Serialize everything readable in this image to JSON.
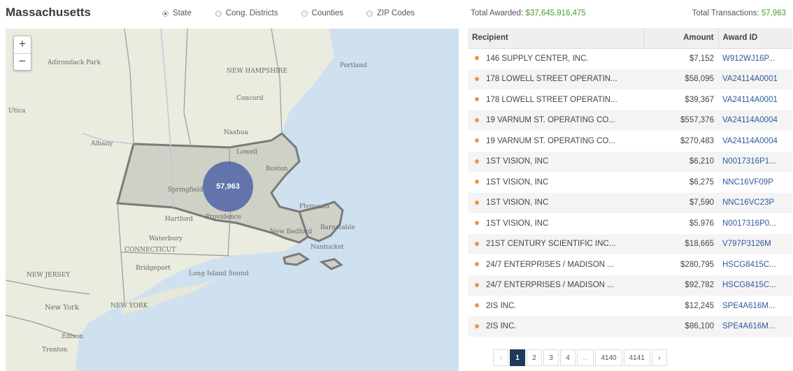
{
  "header": {
    "title": "Massachusetts",
    "radios": [
      {
        "label": "State",
        "selected": true
      },
      {
        "label": "Cong. Districts",
        "selected": false
      },
      {
        "label": "Counties",
        "selected": false
      },
      {
        "label": "ZIP Codes",
        "selected": false
      }
    ],
    "total_awarded_label": "Total Awarded:",
    "total_awarded_value": "$37,645,916,475",
    "total_transactions_label": "Total Transactions:",
    "total_transactions_value": "57,963"
  },
  "map": {
    "zoom_in": "+",
    "zoom_out": "−",
    "bubble_value": "57,963",
    "place_labels": [
      "Adirondack Park",
      "Utica",
      "Albany",
      "NEW HAMPSHIRE",
      "Concord",
      "Nashua",
      "Lowell",
      "Boston",
      "Springfield",
      "Providence",
      "Hartford",
      "Waterbury",
      "CONNECTICUT",
      "Bridgeport",
      "NEW JERSEY",
      "New York",
      "NEW YORK",
      "Long Island Sound",
      "Trenton",
      "Portland",
      "Plymouth",
      "New Bedford",
      "Barnstable",
      "Edison",
      "Nantucket"
    ],
    "colors": {
      "water": "#cfe0ee",
      "land": "#e9ecdf",
      "massachusetts": "#cfd0c6",
      "bubble": "#5466a8"
    }
  },
  "table": {
    "columns": [
      "Recipient",
      "Amount",
      "Award ID"
    ],
    "rows": [
      {
        "recipient": "146 SUPPLY CENTER, INC.",
        "amount": "$7,152",
        "award_id": "W912WJ16P..."
      },
      {
        "recipient": "178 LOWELL STREET OPERATIN...",
        "amount": "$58,095",
        "award_id": "VA24114A0001"
      },
      {
        "recipient": "178 LOWELL STREET OPERATIN...",
        "amount": "$39,367",
        "award_id": "VA24114A0001"
      },
      {
        "recipient": "19 VARNUM ST. OPERATING CO...",
        "amount": "$557,376",
        "award_id": "VA24114A0004"
      },
      {
        "recipient": "19 VARNUM ST. OPERATING CO...",
        "amount": "$270,483",
        "award_id": "VA24114A0004"
      },
      {
        "recipient": "1ST VISION, INC",
        "amount": "$6,210",
        "award_id": "N0017316P1..."
      },
      {
        "recipient": "1ST VISION, INC",
        "amount": "$6,275",
        "award_id": "NNC16VF09P"
      },
      {
        "recipient": "1ST VISION, INC",
        "amount": "$7,590",
        "award_id": "NNC16VC23P"
      },
      {
        "recipient": "1ST VISION, INC",
        "amount": "$5,976",
        "award_id": "N0017316P0..."
      },
      {
        "recipient": "21ST CENTURY SCIENTIFIC INC...",
        "amount": "$18,665",
        "award_id": "V797P3126M"
      },
      {
        "recipient": "24/7 ENTERPRISES / MADISON ...",
        "amount": "$280,795",
        "award_id": "HSCG8415C..."
      },
      {
        "recipient": "24/7 ENTERPRISES / MADISON ...",
        "amount": "$92,782",
        "award_id": "HSCG8415C..."
      },
      {
        "recipient": "2IS INC.",
        "amount": "$12,245",
        "award_id": "SPE4A616M..."
      },
      {
        "recipient": "2IS INC.",
        "amount": "$86,100",
        "award_id": "SPE4A616M..."
      }
    ],
    "bullet_color": "#f0973f",
    "link_color": "#2f5c9a"
  },
  "pagination": {
    "prev": "‹",
    "pages": [
      "1",
      "2",
      "3",
      "4",
      "...",
      "4140",
      "4141"
    ],
    "active_page": "1",
    "next": "›"
  }
}
